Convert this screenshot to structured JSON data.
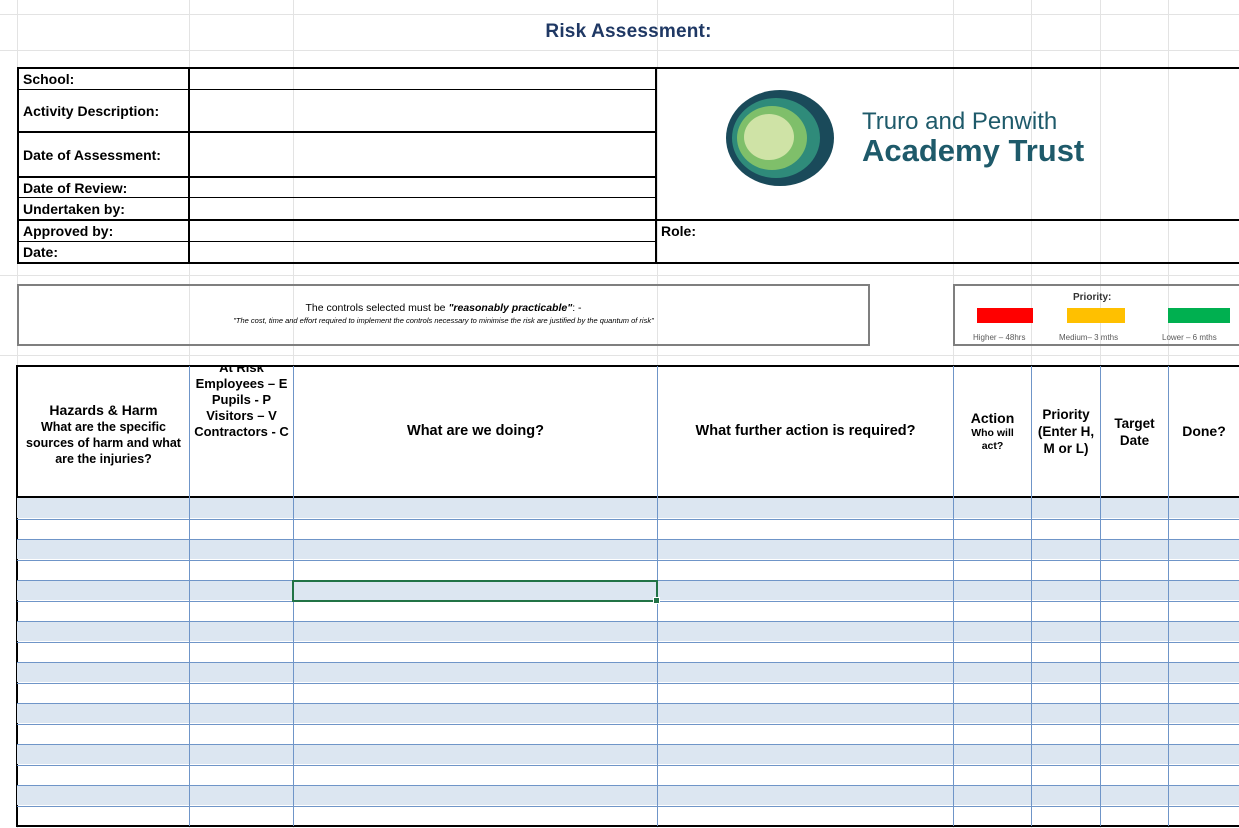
{
  "title": "Risk Assessment:",
  "info_labels": {
    "school": "School:",
    "activity": "Activity Description:",
    "date_of_assessment": "Date of Assessment:",
    "date_of_review": "Date of Review:",
    "undertaken_by": "Undertaken by:",
    "approved_by": "Approved by:",
    "date": "Date:",
    "role": "Role:"
  },
  "logo": {
    "line1": "Truro and Penwith",
    "line2": "Academy Trust",
    "colors": {
      "outer": "#1a4a5a",
      "ring2": "#2f8b7a",
      "ring3": "#7fbf6a",
      "inner": "#cfe3a6",
      "text": "#1e5a6a"
    }
  },
  "controls": {
    "intro": "The controls selected must be ",
    "emphasis": "\"reasonably practicable\"",
    "suffix": ": -",
    "quote": "\"The cost, time and effort required to implement the controls necessary to minimise the risk are justified by the quantum of risk\""
  },
  "priority": {
    "title": "Priority:",
    "levels": [
      {
        "label": "Higher – 48hrs",
        "color": "#ff0000"
      },
      {
        "label": "Medium– 3 mths",
        "color": "#ffc000"
      },
      {
        "label": "Lower – 6 mths",
        "color": "#00b050"
      }
    ]
  },
  "table": {
    "headers": {
      "hazards_title": "Hazards & Harm",
      "hazards_sub": "What are the specific sources of harm and what are the injuries?",
      "at_risk": "At Risk",
      "at_risk_lines": [
        "Employees – E",
        "Pupils - P",
        "Visitors – V",
        "Contractors - C"
      ],
      "doing": "What are we doing?",
      "further": "What further action is required?",
      "action": "Action",
      "action_sub": "Who will act?",
      "priority": "Priority (Enter H, M or L)",
      "target": "Target Date",
      "done": "Done?"
    }
  },
  "colors": {
    "title": "#1f3864",
    "band": "#dce6f1",
    "grid": "#6f95c8",
    "selection": "#217346"
  }
}
